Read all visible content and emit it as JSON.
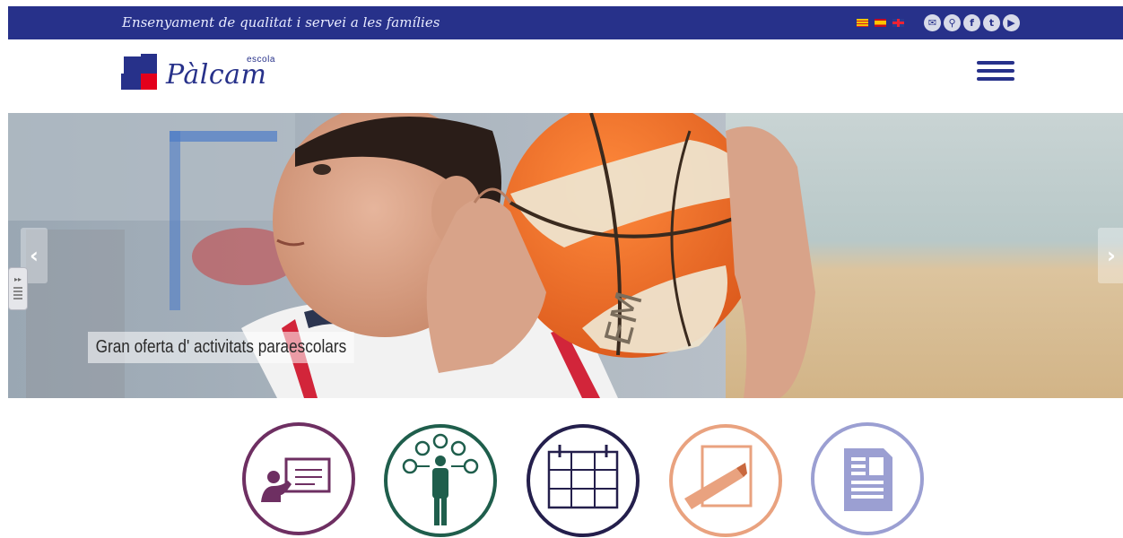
{
  "topbar": {
    "tagline": "Ensenyament de qualitat i servei a les famílies",
    "languages": [
      {
        "code": "ca",
        "name": "catalan-flag-icon"
      },
      {
        "code": "es",
        "name": "spanish-flag-icon"
      },
      {
        "code": "en",
        "name": "uk-flag-icon"
      }
    ],
    "socials": [
      {
        "name": "email-icon",
        "glyph": "✉"
      },
      {
        "name": "location-pin-icon",
        "glyph": "⚲"
      },
      {
        "name": "facebook-icon",
        "glyph": "f"
      },
      {
        "name": "twitter-icon",
        "glyph": "t"
      },
      {
        "name": "youtube-icon",
        "glyph": "▶"
      }
    ],
    "background": "#27318a"
  },
  "header": {
    "logo_text": "Pàlcam",
    "logo_sub": "escola",
    "menu_icon": "hamburger-menu-icon"
  },
  "slider": {
    "caption": "Gran oferta d' activitats paraescolars",
    "prev_glyph": "‹",
    "next_glyph": "›",
    "handle_glyph": "▸▸"
  },
  "features": [
    {
      "name": "teacher-board-icon",
      "color": "#6e2f62"
    },
    {
      "name": "people-network-icon",
      "color": "#1f5e4c"
    },
    {
      "name": "calendar-icon",
      "color": "#241f4c"
    },
    {
      "name": "pencil-paper-icon",
      "color": "#e9a27f"
    },
    {
      "name": "document-icon",
      "color": "#9b9fd2"
    }
  ],
  "colors": {
    "brand_blue": "#27318a",
    "logo_red": "#e3001b"
  }
}
